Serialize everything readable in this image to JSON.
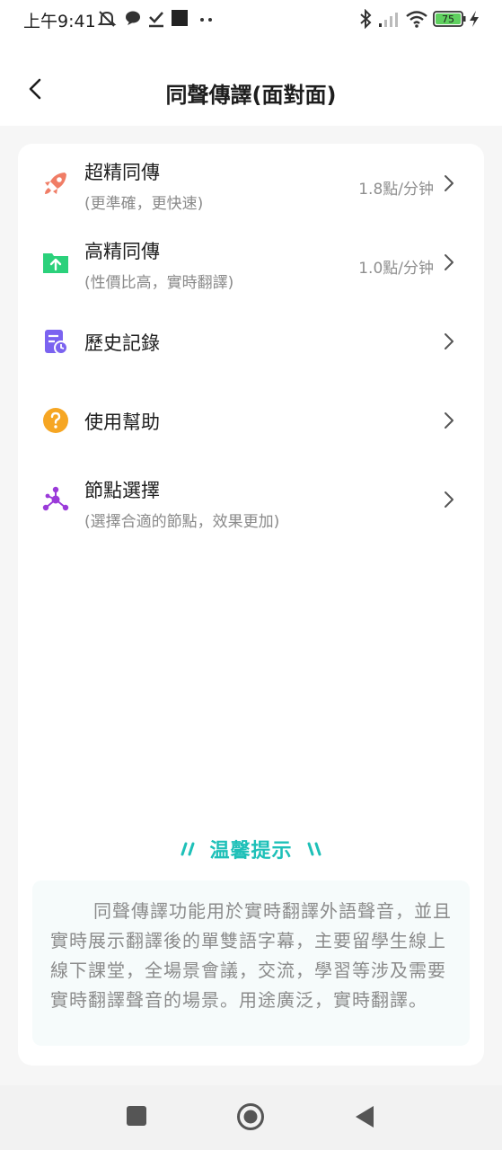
{
  "status_bar": {
    "time": "上午9:41",
    "battery": "75"
  },
  "header": {
    "title": "同聲傳譯(面對面)"
  },
  "menu": {
    "items": [
      {
        "title": "超精同傳",
        "subtitle": "(更準確，更快速)",
        "price": "1.8點/分钟",
        "icon": "rocket-icon",
        "color": "#f07d66"
      },
      {
        "title": "高精同傳",
        "subtitle": "(性價比高，實時翻譯)",
        "price": "1.0點/分钟",
        "icon": "folder-upload-icon",
        "color": "#2bd17b"
      },
      {
        "title": "歷史記錄",
        "icon": "history-icon",
        "color": "#7b63f0"
      },
      {
        "title": "使用幫助",
        "icon": "help-icon",
        "color": "#f6a623"
      },
      {
        "title": "節點選擇",
        "subtitle": "(選擇合適的節點，效果更加)",
        "icon": "node-icon",
        "color": "#9a3ad9"
      }
    ]
  },
  "tip": {
    "title": "温馨提示",
    "text": "同聲傳譯功能用於實時翻譯外語聲音，並且實時展示翻譯後的單雙語字幕，主要留學生線上線下課堂，全場景會議，交流，學習等涉及需要實時翻譯聲音的場景。用途廣泛，實時翻譯。"
  },
  "colors": {
    "accent": "#1ec0b8",
    "background": "#f6f6f6",
    "card": "#ffffff"
  }
}
